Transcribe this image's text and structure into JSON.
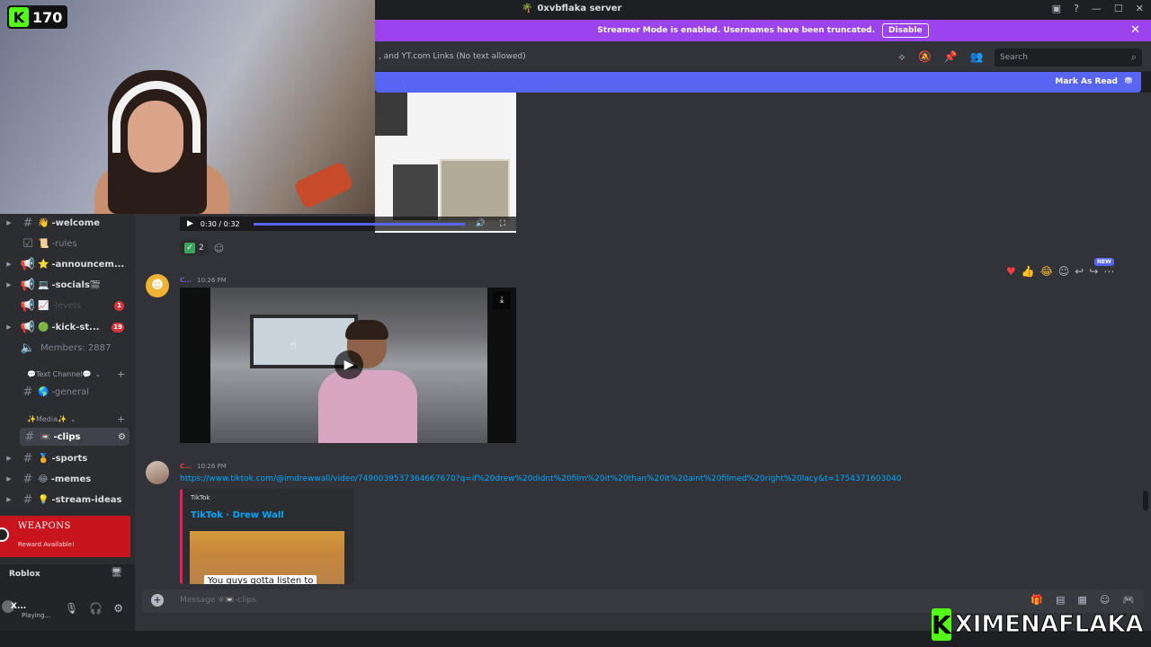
{
  "titlebar": {
    "server_name": "0xvbflaka server",
    "icons": [
      "inbox-icon",
      "help-icon",
      "minimize-icon",
      "maximize-icon",
      "close-icon"
    ]
  },
  "banner": {
    "text": "Streamer Mode is enabled. Usernames have been truncated.",
    "button": "Disable",
    "color": "#9b43ee"
  },
  "channel_header": {
    "topic": ", and YT.com Links (No text allowed)",
    "search_placeholder": "Search"
  },
  "new_messages": {
    "mark_as_read": "Mark As Read",
    "color": "#5865f2"
  },
  "stream": {
    "follower_count": "170",
    "watermark_name": "XIMENAFLAKA",
    "kick_color": "#53fc18"
  },
  "sidebar": {
    "channels": [
      {
        "emoji": "👋",
        "label": "-welcome",
        "style": "bold"
      },
      {
        "emoji": "📜",
        "label": "-rules",
        "style": "dim"
      },
      {
        "emoji": "⭐",
        "label": "-announcem...",
        "style": "bold"
      },
      {
        "emoji": "💻",
        "label": "-socials🎬",
        "style": "bold"
      },
      {
        "emoji": "📈",
        "label": "-levels",
        "style": "muted",
        "badge": "1"
      },
      {
        "emoji": "🟢",
        "label": "-kick-st...",
        "style": "bold",
        "badge": "19"
      },
      {
        "emoji": "🔇",
        "label": "Members: 2887",
        "style": "dim"
      }
    ],
    "category_text": "💬Text Channel💬",
    "general": {
      "emoji": "🌎",
      "label": "-general"
    },
    "category_media": "✨Media✨",
    "media_channels": [
      {
        "emoji": "📼",
        "label": "-clips",
        "selected": true
      },
      {
        "emoji": "🏅",
        "label": "-sports"
      },
      {
        "emoji": "😂",
        "label": "-memes"
      },
      {
        "emoji": "💡",
        "label": "-stream-ideas"
      }
    ],
    "promo": {
      "title": "WEAPONS",
      "subtitle": "Reward Available!"
    },
    "activity": {
      "game": "Roblox"
    },
    "user": {
      "name": "X...",
      "status": "Playing..."
    }
  },
  "messages": {
    "video1": {
      "time": "0:30 / 0:32",
      "progress": 1.0
    },
    "reaction": {
      "emoji": "✅",
      "count": "2"
    },
    "msg1": {
      "user": "C...",
      "time": "10:26 PM"
    },
    "hover_new_tag": "NEW",
    "msg2": {
      "user": "C...",
      "time": "10:26 PM",
      "link": "https://www.tiktok.com/@imdrewwall/video/7490039537364667670?q=if%20drew%20didnt%20film%20it%20than%20it%20aint%20filmed%20right%20lacy&t=1754371603040",
      "embed_provider": "TikTok",
      "embed_title": "TikTok · Drew Wall",
      "embed_caption": "You guys gotta listen to"
    }
  },
  "composer": {
    "placeholder": "Message #📼-clips"
  }
}
